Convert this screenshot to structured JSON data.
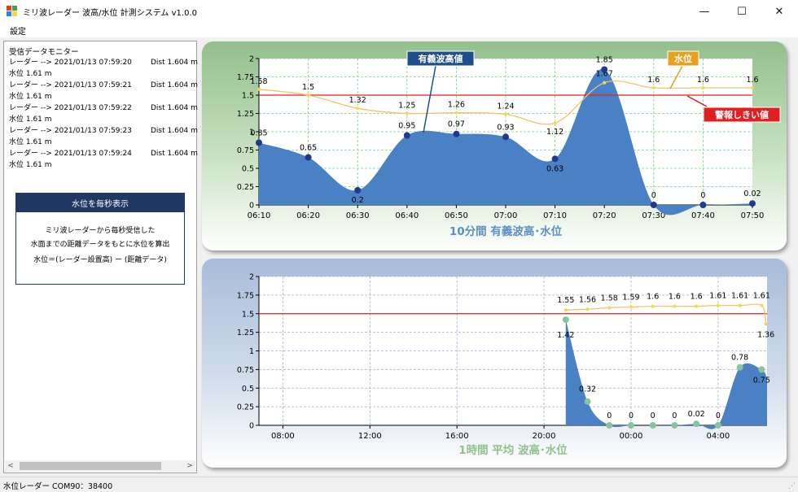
{
  "window": {
    "title": "ミリ波レーダー 波高/水位 計測システム v1.0.0",
    "minimize_glyph": "—",
    "maximize_glyph": "☐",
    "close_glyph": "✕",
    "icon": "app-grid-icon"
  },
  "menu": {
    "settings": "設定"
  },
  "monitor": {
    "title": "受信データモニター",
    "lines": [
      {
        "main": "レーダー  -->  2021/01/13 07:59:20",
        "dist": "Dist 1.604 m"
      },
      {
        "main": "水位 1.61 m",
        "dist": ""
      },
      {
        "main": "レーダー  -->  2021/01/13 07:59:21",
        "dist": "Dist 1.604 m"
      },
      {
        "main": "水位 1.61 m",
        "dist": ""
      },
      {
        "main": "レーダー  -->  2021/01/13 07:59:22",
        "dist": "Dist 1.604 m"
      },
      {
        "main": "水位 1.61 m",
        "dist": ""
      },
      {
        "main": "レーダー  -->  2021/01/13 07:59:23",
        "dist": "Dist 1.604 m"
      },
      {
        "main": "水位 1.61 m",
        "dist": ""
      },
      {
        "main": "レーダー  -->  2021/01/13 07:59:24",
        "dist": "Dist 1.604 m"
      },
      {
        "main": "水位 1.61 m",
        "dist": ""
      }
    ],
    "infobox": {
      "title": "水位を毎秒表示",
      "line1": "ミリ波レーダーから毎秒受信した",
      "line2": "水面までの距離データをもとに水位を算出",
      "line3": "水位＝(レーダー設置高) ー (距離データ)"
    },
    "scroll_left": "<",
    "scroll_right": ">"
  },
  "status": {
    "text": "水位レーダー COM90：38400",
    "grip": "⋰"
  },
  "colors": {
    "wave_fill": "#4a80c4",
    "wave_marker": "#1f3a8a",
    "level_line": "#f5c26b",
    "level_marker": "#f2d94e",
    "threshold": "#e02020",
    "wave_callout": "#1f4e8c",
    "level_callout": "#e8a020",
    "threshold_callout": "#e02020",
    "title_top": "#5b8ec4",
    "title_bottom": "#8fc28a",
    "bottom_wave_marker": "#88c4a0"
  },
  "chart_data": [
    {
      "type": "area",
      "title": "10分間  有義波高･水位",
      "x_labels": [
        "06:10",
        "06:20",
        "06:30",
        "06:40",
        "06:50",
        "07:00",
        "07:10",
        "07:20",
        "07:30",
        "07:40",
        "07:50"
      ],
      "ylim": [
        0,
        2
      ],
      "y_ticks": [
        "0",
        "0.25",
        "0.5",
        "0.75",
        "1",
        "1.25",
        "1.5",
        "1.75",
        "2"
      ],
      "grid": true,
      "threshold": 1.5,
      "series": [
        {
          "name": "有義波高値",
          "values": [
            0.85,
            0.65,
            0.2,
            0.95,
            0.97,
            0.93,
            0.63,
            1.85,
            0,
            0,
            0.02
          ],
          "labels": [
            "0.85",
            "0.65",
            "0.2",
            "0.95",
            "0.97",
            "0.93",
            "0.63",
            "1.85",
            "0",
            "0",
            "0.02"
          ]
        },
        {
          "name": "水位",
          "values": [
            1.58,
            1.5,
            1.32,
            1.25,
            1.26,
            1.24,
            1.12,
            1.67,
            1.6,
            1.6,
            1.6
          ],
          "labels": [
            "1.58",
            "1.5",
            "1.32",
            "1.25",
            "1.26",
            "1.24",
            "1.12",
            "1.67",
            "1.6",
            "1.6",
            "1.6"
          ]
        }
      ],
      "callouts": {
        "wave": "有義波高値",
        "level": "水位",
        "threshold": "警報しきい値"
      }
    },
    {
      "type": "area",
      "title": "1時間  平均 波高･水位",
      "x_labels": [
        "08:00",
        "12:00",
        "16:00",
        "20:00",
        "00:00",
        "04:00"
      ],
      "x_label_hours": [
        8,
        12,
        16,
        20,
        24,
        28
      ],
      "x_range_hours": [
        6.9,
        30.25
      ],
      "ylim": [
        0,
        2
      ],
      "y_ticks": [
        "0",
        "0.25",
        "0.5",
        "0.75",
        "1",
        "1.25",
        "1.5",
        "1.75",
        "2"
      ],
      "grid": true,
      "threshold": 1.5,
      "series": [
        {
          "name": "",
          "x_hours": [
            21,
            22,
            23,
            24,
            25,
            26,
            27,
            28,
            29,
            30
          ],
          "values": [
            1.42,
            0.32,
            0,
            0,
            0,
            0,
            0.02,
            0,
            0.78,
            0.75
          ],
          "labels": [
            "1.42",
            "0.32",
            "0",
            "0",
            "0",
            "0",
            "0.02",
            "0",
            "0.78",
            "0.75"
          ]
        },
        {
          "name": "",
          "x_hours": [
            21,
            22,
            23,
            24,
            25,
            26,
            27,
            28,
            29,
            30,
            30.2
          ],
          "values": [
            1.55,
            1.56,
            1.58,
            1.59,
            1.6,
            1.6,
            1.6,
            1.61,
            1.61,
            1.61,
            1.36
          ],
          "labels": [
            "1.55",
            "1.56",
            "1.58",
            "1.59",
            "1.6",
            "1.6",
            "1.6",
            "1.61",
            "1.61",
            "1.61",
            "1.36"
          ]
        }
      ]
    }
  ]
}
